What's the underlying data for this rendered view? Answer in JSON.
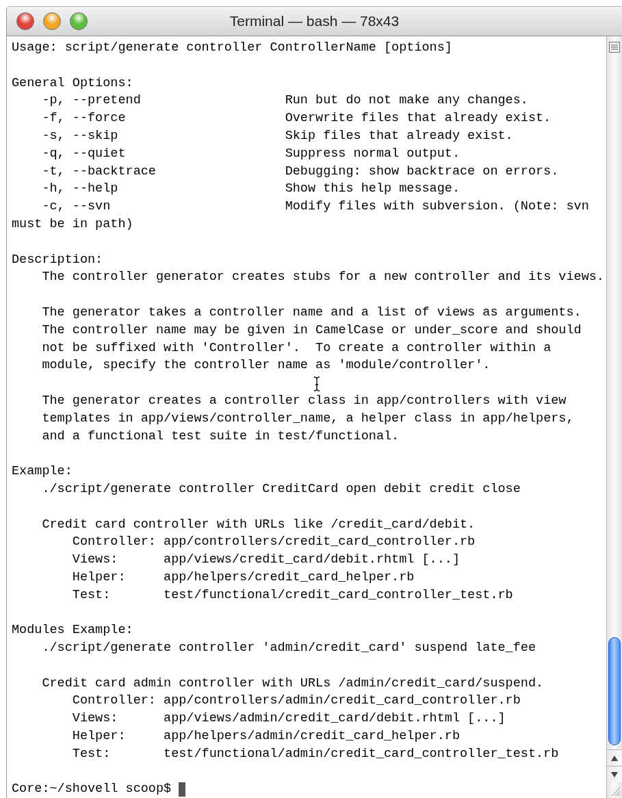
{
  "window": {
    "title": "Terminal — bash — 78x43"
  },
  "usage": "Usage: script/generate controller ControllerName [options]",
  "sections": [
    {
      "kind": "options",
      "heading": "General Options:",
      "options": [
        {
          "flag": "-p, --pretend",
          "description": "Run but do not make any changes."
        },
        {
          "flag": "-f, --force",
          "description": "Overwrite files that already exist."
        },
        {
          "flag": "-s, --skip",
          "description": "Skip files that already exist."
        },
        {
          "flag": "-q, --quiet",
          "description": "Suppress normal output."
        },
        {
          "flag": "-t, --backtrace",
          "description": "Debugging: show backtrace on errors."
        },
        {
          "flag": "-h, --help",
          "description": "Show this help message."
        },
        {
          "flag": "-c, --svn",
          "description": "Modify files with subversion. (Note: svn",
          "wrap": "must be in path)"
        }
      ]
    },
    {
      "kind": "paragraphs",
      "heading": "Description:",
      "paragraphs": [
        [
          "The controller generator creates stubs for a new controller and its views."
        ],
        [
          "The generator takes a controller name and a list of views as arguments.",
          "The controller name may be given in CamelCase or under_score and should",
          "not be suffixed with 'Controller'.  To create a controller within a",
          "module, specify the controller name as 'module/controller'."
        ],
        [
          "The generator creates a controller class in app/controllers with view",
          "templates in app/views/controller_name, a helper class in app/helpers,",
          "and a functional test suite in test/functional."
        ]
      ]
    },
    {
      "kind": "example",
      "heading": "Example:",
      "command": "./script/generate controller CreditCard open debit credit close",
      "summary": "Credit card controller with URLs like /credit_card/debit.",
      "files": [
        {
          "label": "Controller:",
          "path": "app/controllers/credit_card_controller.rb"
        },
        {
          "label": "Views:",
          "path": "app/views/credit_card/debit.rhtml [...]"
        },
        {
          "label": "Helper:",
          "path": "app/helpers/credit_card_helper.rb"
        },
        {
          "label": "Test:",
          "path": "test/functional/credit_card_controller_test.rb"
        }
      ]
    },
    {
      "kind": "example",
      "heading": "Modules Example:",
      "command": "./script/generate controller 'admin/credit_card' suspend late_fee",
      "summary": "Credit card admin controller with URLs /admin/credit_card/suspend.",
      "files": [
        {
          "label": "Controller:",
          "path": "app/controllers/admin/credit_card_controller.rb"
        },
        {
          "label": "Views:",
          "path": "app/views/admin/credit_card/debit.rhtml [...]"
        },
        {
          "label": "Helper:",
          "path": "app/helpers/admin/credit_card_helper.rb"
        },
        {
          "label": "Test:",
          "path": "test/functional/admin/credit_card_controller_test.rb"
        }
      ]
    }
  ],
  "prompt": "Core:~/shovell scoop$"
}
